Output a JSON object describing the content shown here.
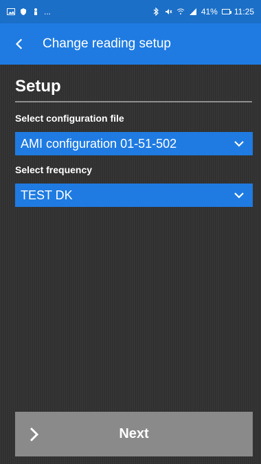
{
  "status_bar": {
    "left_icons": [
      "image-icon",
      "shield-icon",
      "person-icon"
    ],
    "left_ellipsis": "...",
    "battery": "41%",
    "time": "11:25",
    "right_icons": [
      "bluetooth-icon",
      "muted-icon",
      "wifi-icon",
      "signal-icon",
      "battery-icon"
    ]
  },
  "toolbar": {
    "title": "Change reading setup",
    "back_icon": "chevron-left-icon"
  },
  "setup": {
    "title": "Setup",
    "config_label": "Select configuration file",
    "config_value": "AMI configuration 01-51-502",
    "frequency_label": "Select frequency",
    "frequency_value": "TEST DK"
  },
  "actions": {
    "next_label": "Next",
    "next_icon": "chevron-right-icon"
  },
  "colors": {
    "status_bar": "#1b6fc7",
    "toolbar": "#1f7be2",
    "background": "#303030",
    "select_fill": "#1f7be2",
    "next_button": "#8a8a8a",
    "text": "#ffffff"
  }
}
